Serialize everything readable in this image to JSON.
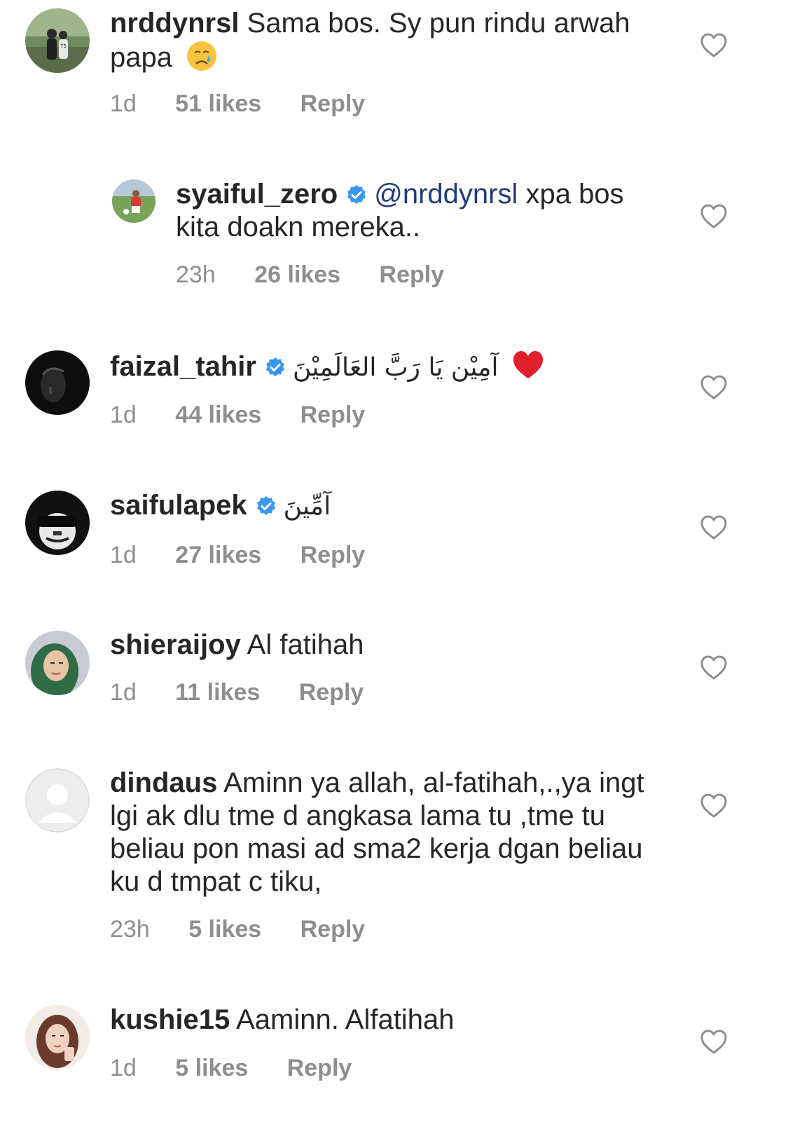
{
  "comments": [
    {
      "username": "nrddynrsl",
      "text": "Sama bos. Sy pun rindu arwah papa",
      "emoji": "crying-face-emoji",
      "time": "1d",
      "likes": "51 likes",
      "reply_label": "Reply"
    },
    {
      "username": "syaiful_zero",
      "verified": true,
      "mention": "@nrddynrsl",
      "text": " xpa bos kita doakn mereka..",
      "time": "23h",
      "likes": "26 likes",
      "reply_label": "Reply"
    },
    {
      "username": "faizal_tahir",
      "verified": true,
      "text": "آمِيْن يَا رَبَّ العَالَمِيْنَ",
      "emoji": "red-heart-emoji",
      "time": "1d",
      "likes": "44 likes",
      "reply_label": "Reply"
    },
    {
      "username": "saifulapek",
      "verified": true,
      "text": "آمِّينَ",
      "time": "1d",
      "likes": "27 likes",
      "reply_label": "Reply"
    },
    {
      "username": "shieraijoy",
      "text": "Al fatihah",
      "time": "1d",
      "likes": "11 likes",
      "reply_label": "Reply"
    },
    {
      "username": "dindaus",
      "text": "Aminn ya allah, al-fatihah,.,ya ingt lgi ak dlu tme d angkasa lama tu ,tme tu beliau pon masi ad sma2 kerja dgan beliau ku d tmpat c tiku,",
      "time": "23h",
      "likes": "5 likes",
      "reply_label": "Reply"
    },
    {
      "username": "kushie15",
      "text": "Aaminn. Alfatihah",
      "time": "1d",
      "likes": "5 likes",
      "reply_label": "Reply"
    }
  ],
  "colors": {
    "text": "#262626",
    "meta": "#8e8e8e",
    "mention": "#1f3c7a",
    "verified": "#3897f0",
    "heart_outline": "#8e8e8e"
  }
}
